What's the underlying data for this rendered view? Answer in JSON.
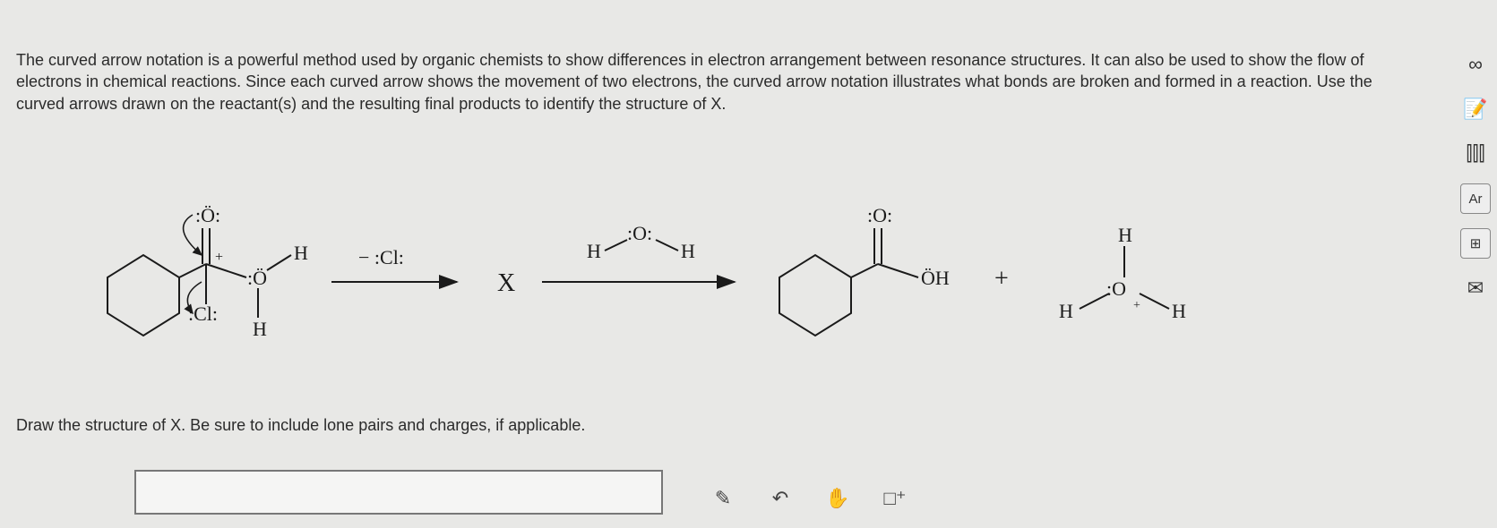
{
  "prompt": {
    "paragraph": "The curved arrow notation is a powerful method used by organic chemists to show differences in electron arrangement between resonance structures. It can also be used to show the flow of electrons in chemical reactions. Since each curved arrow shows the movement of two electrons, the curved arrow notation illustrates what bonds are broken and formed in a reaction. Use the curved arrows drawn on the reactant(s) and the resulting final products to identify the structure of X."
  },
  "reaction": {
    "reagent_above": "− :Cl:",
    "intermediate_label": "X",
    "water_reagent": {
      "left_H": "H",
      "O": ":O:",
      "right_H": "H"
    },
    "reactant": {
      "top_O": ":Ö:",
      "plus_charge": "+",
      "Cl": ":Cl:",
      "O_right": ":Ö",
      "H_top": "H",
      "H_bottom": "H"
    },
    "product1": {
      "top_O": ":O:",
      "OH": "ÖH"
    },
    "plus_sign": "+",
    "product2": {
      "H_top": "H",
      "O_center": ":O",
      "plus_charge": "+",
      "H_left": "H",
      "H_right": "H"
    }
  },
  "instruction": "Draw the structure of X. Be sure to include lone pairs and charges, if applicable.",
  "toolbar": {
    "draw": "✎",
    "undo": "↶",
    "hand": "✋",
    "charge": "□⁺"
  },
  "sidebar": {
    "infinity": "∞",
    "note": "📝",
    "bars": "⫿⫿⫿",
    "ar": "Ar",
    "periodic": "⊞",
    "mail": "✉"
  }
}
